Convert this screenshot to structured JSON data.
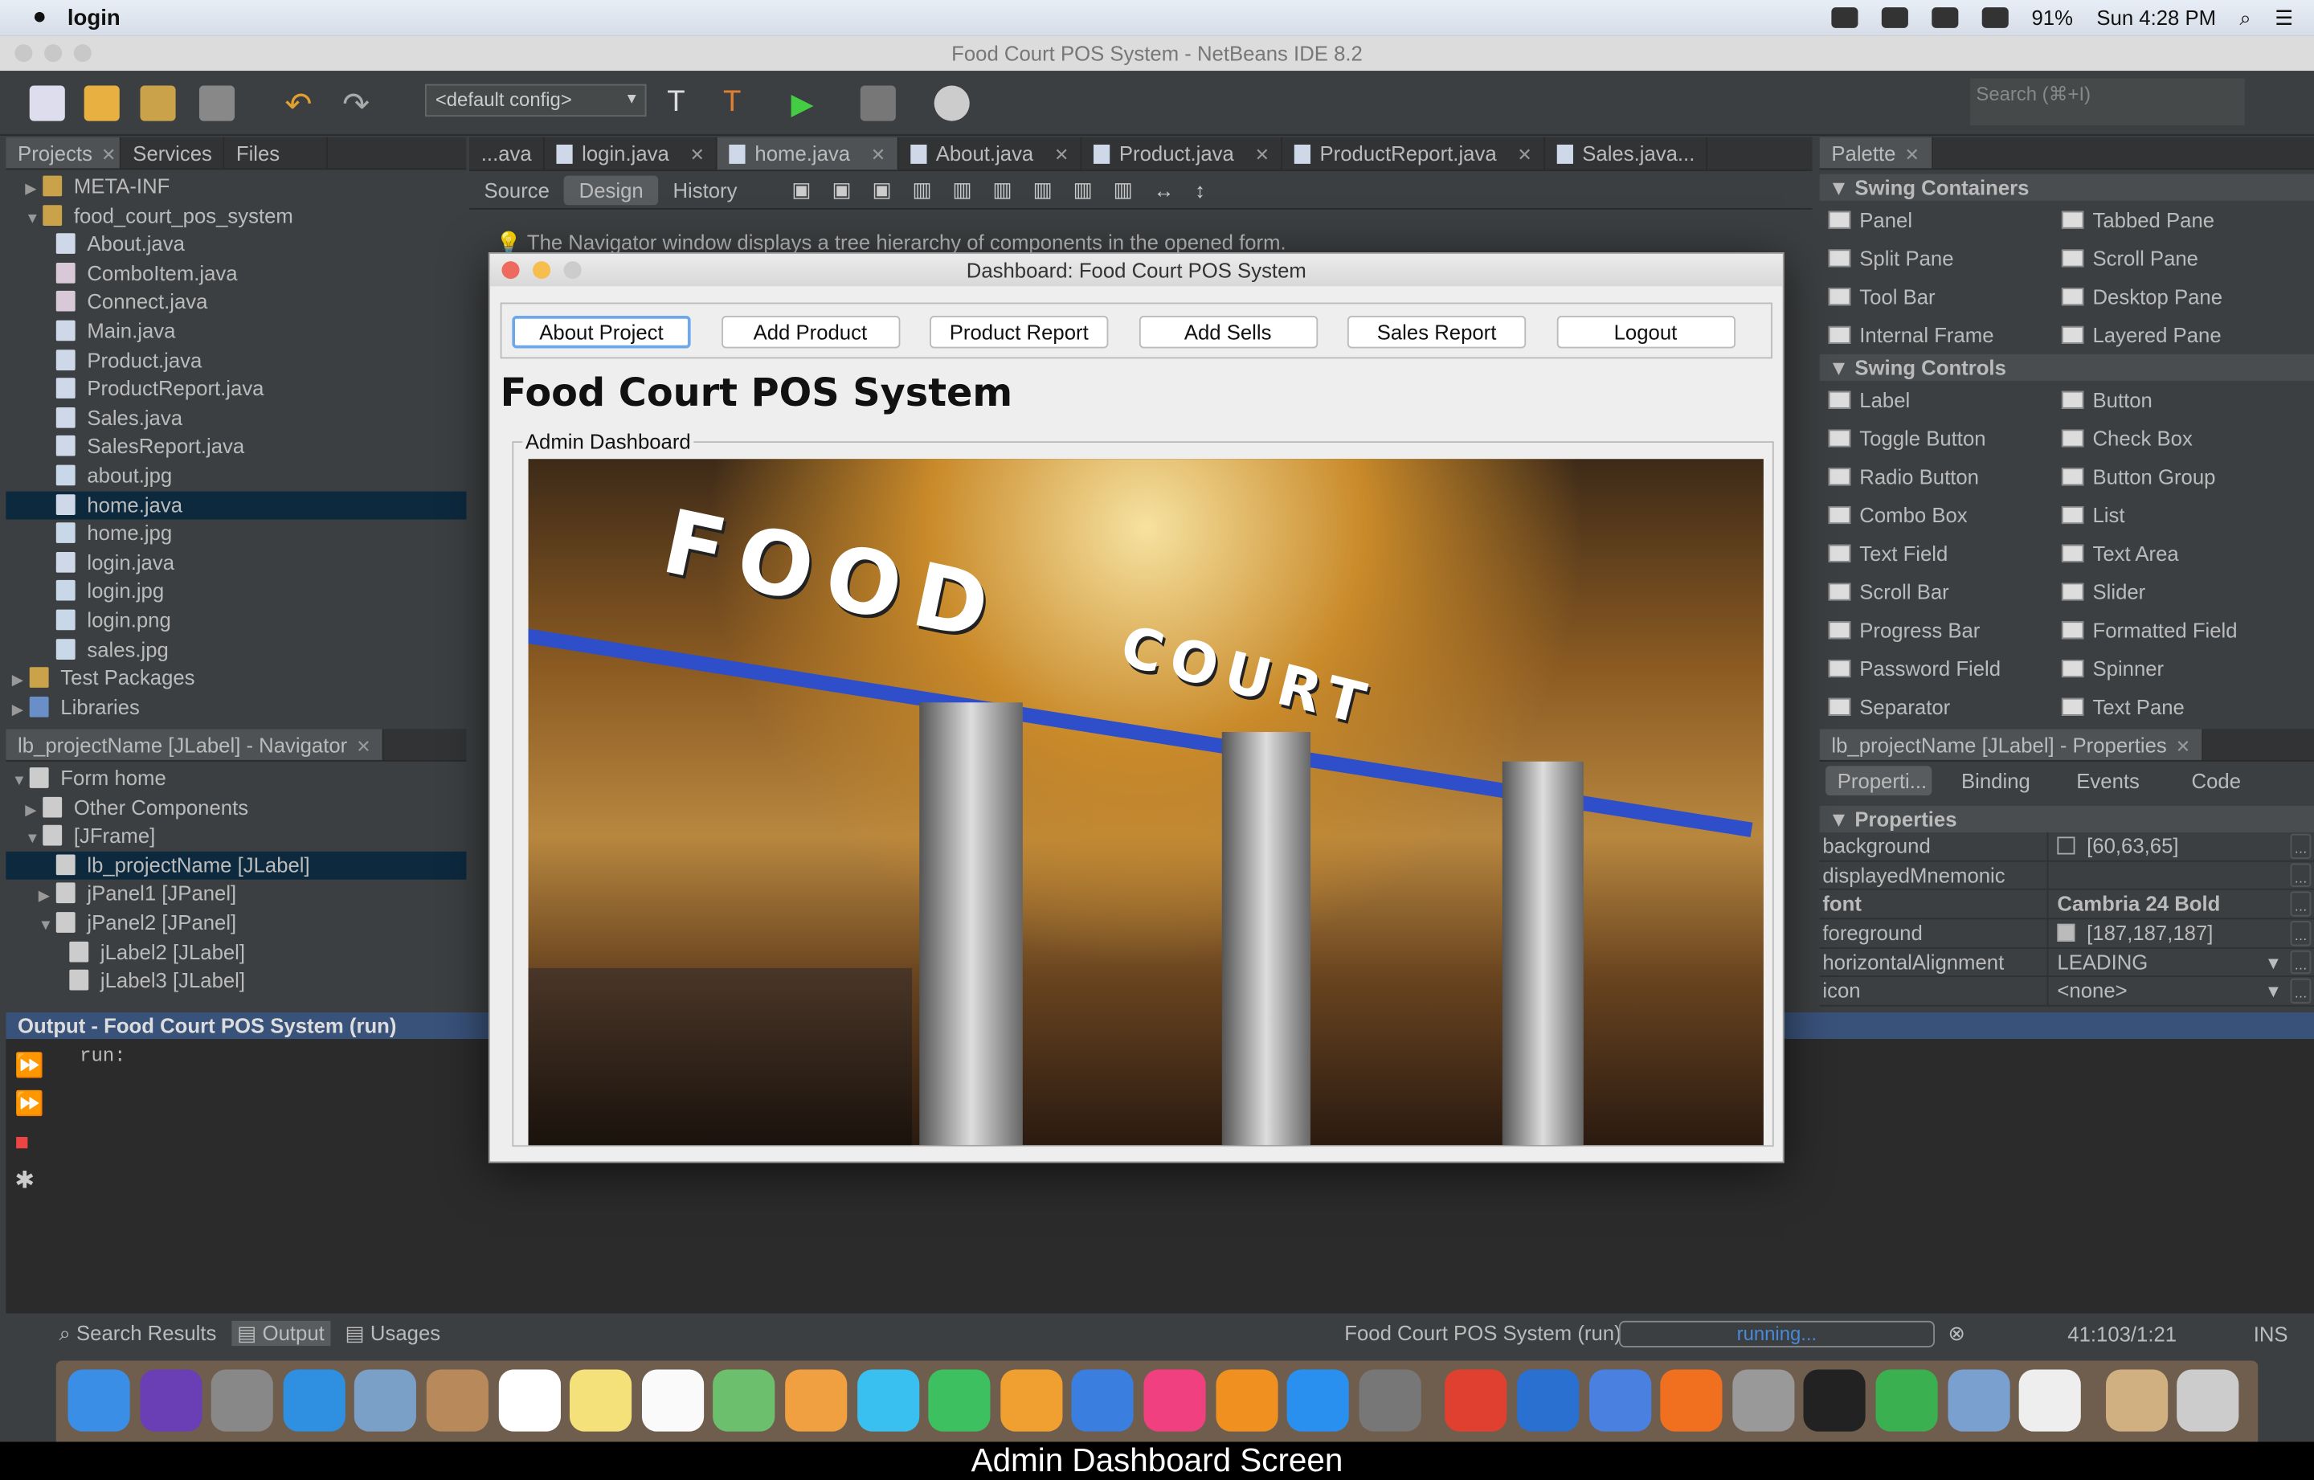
{
  "menubar": {
    "app": "login",
    "clock": "Sun 4:28 PM",
    "battery": "91%"
  },
  "window": {
    "title": "Food Court POS System - NetBeans IDE 8.2"
  },
  "toolbar": {
    "config": "<default config>",
    "search_placeholder": "Search (⌘+I)"
  },
  "projects": {
    "tabs": [
      "Projects",
      "Services",
      "Files"
    ],
    "tree": [
      {
        "label": "META-INF",
        "depth": 1,
        "arrow": "▶",
        "icon": "package"
      },
      {
        "label": "food_court_pos_system",
        "depth": 1,
        "arrow": "▼",
        "icon": "package"
      },
      {
        "label": "About.java",
        "depth": 2,
        "icon": "form"
      },
      {
        "label": "ComboItem.java",
        "depth": 2,
        "icon": "java"
      },
      {
        "label": "Connect.java",
        "depth": 2,
        "icon": "java"
      },
      {
        "label": "Main.java",
        "depth": 2,
        "icon": "form"
      },
      {
        "label": "Product.java",
        "depth": 2,
        "icon": "form"
      },
      {
        "label": "ProductReport.java",
        "depth": 2,
        "icon": "form"
      },
      {
        "label": "Sales.java",
        "depth": 2,
        "icon": "form"
      },
      {
        "label": "SalesReport.java",
        "depth": 2,
        "icon": "form"
      },
      {
        "label": "about.jpg",
        "depth": 2,
        "icon": "image"
      },
      {
        "label": "home.java",
        "depth": 2,
        "icon": "form",
        "selected": true
      },
      {
        "label": "home.jpg",
        "depth": 2,
        "icon": "image"
      },
      {
        "label": "login.java",
        "depth": 2,
        "icon": "form"
      },
      {
        "label": "login.jpg",
        "depth": 2,
        "icon": "image"
      },
      {
        "label": "login.png",
        "depth": 2,
        "icon": "image"
      },
      {
        "label": "sales.jpg",
        "depth": 2,
        "icon": "image"
      },
      {
        "label": "Test Packages",
        "depth": 0,
        "arrow": "▶",
        "icon": "package"
      },
      {
        "label": "Libraries",
        "depth": 0,
        "arrow": "▶",
        "icon": "library"
      }
    ]
  },
  "navigator": {
    "title": "lb_projectName [JLabel] - Navigator",
    "tree": [
      {
        "label": "Form home",
        "depth": 0,
        "arrow": "▼"
      },
      {
        "label": "Other Components",
        "depth": 1,
        "arrow": "▶"
      },
      {
        "label": "[JFrame]",
        "depth": 1,
        "arrow": "▼"
      },
      {
        "label": "lb_projectName [JLabel]",
        "depth": 2,
        "selected": true
      },
      {
        "label": "jPanel1 [JPanel]",
        "depth": 2,
        "arrow": "▶"
      },
      {
        "label": "jPanel2 [JPanel]",
        "depth": 2,
        "arrow": "▼"
      },
      {
        "label": "jLabel2 [JLabel]",
        "depth": 3
      },
      {
        "label": "jLabel3 [JLabel]",
        "depth": 3
      }
    ]
  },
  "editor": {
    "tabs": [
      {
        "label": "...ava"
      },
      {
        "label": "login.java"
      },
      {
        "label": "home.java",
        "active": true
      },
      {
        "label": "About.java"
      },
      {
        "label": "Product.java"
      },
      {
        "label": "ProductReport.java"
      },
      {
        "label": "Sales.java..."
      }
    ],
    "modes": [
      "Source",
      "Design",
      "History"
    ],
    "active_mode": "Design",
    "hint": "The Navigator window displays a tree hierarchy of components in the opened form."
  },
  "dialog": {
    "title": "Dashboard: Food Court POS System",
    "buttons": [
      "About Project",
      "Add Product",
      "Product Report",
      "Add Sells",
      "Sales Report",
      "Logout"
    ],
    "heading": "Food Court POS System",
    "panel_title": "Admin Dashboard",
    "photo_sign": "FOOD COURT"
  },
  "palette": {
    "title": "Palette",
    "categories": [
      {
        "name": "Swing Containers",
        "items": [
          "Panel",
          "Tabbed Pane",
          "Split Pane",
          "Scroll Pane",
          "Tool Bar",
          "Desktop Pane",
          "Internal Frame",
          "Layered Pane"
        ]
      },
      {
        "name": "Swing Controls",
        "items": [
          "Label",
          "Button",
          "Toggle Button",
          "Check Box",
          "Radio Button",
          "Button Group",
          "Combo Box",
          "List",
          "Text Field",
          "Text Area",
          "Scroll Bar",
          "Slider",
          "Progress Bar",
          "Formatted Field",
          "Password Field",
          "Spinner",
          "Separator",
          "Text Pane"
        ]
      }
    ]
  },
  "properties": {
    "title": "lb_projectName [JLabel] - Properties",
    "tabs": [
      "Properti...",
      "Binding",
      "Events",
      "Code"
    ],
    "section": "Properties",
    "rows": [
      {
        "name": "background",
        "value": "[60,63,65]",
        "swatch": "#3c3f41"
      },
      {
        "name": "displayedMnemonic",
        "value": ""
      },
      {
        "name": "font",
        "value": "Cambria 24 Bold",
        "bold": true
      },
      {
        "name": "foreground",
        "value": "[187,187,187]",
        "swatch": "#bbbbbb"
      },
      {
        "name": "horizontalAlignment",
        "value": "LEADING",
        "dropdown": true
      },
      {
        "name": "icon",
        "value": "<none>",
        "dropdown": true
      }
    ]
  },
  "output": {
    "title": "Output - Food Court POS System (run)",
    "text": "run:"
  },
  "status": {
    "tabs": [
      "Search Results",
      "Output",
      "Usages"
    ],
    "task": "Food Court POS System (run)",
    "progress_text": "running...",
    "position": "41:103/1:21",
    "mode": "INS"
  },
  "dock": {
    "apps": [
      {
        "name": "finder",
        "color": "#3a8ee6"
      },
      {
        "name": "siri",
        "color": "#6a3fb5"
      },
      {
        "name": "launchpad",
        "color": "#888"
      },
      {
        "name": "safari",
        "color": "#2f8fe0"
      },
      {
        "name": "mail",
        "color": "#7aa0c8"
      },
      {
        "name": "contacts",
        "color": "#b8895a"
      },
      {
        "name": "calendar",
        "color": "#fff"
      },
      {
        "name": "notes",
        "color": "#f5e17a"
      },
      {
        "name": "reminders",
        "color": "#fafafa"
      },
      {
        "name": "maps",
        "color": "#6cbf6c"
      },
      {
        "name": "photos",
        "color": "#f0a040"
      },
      {
        "name": "messages",
        "color": "#3ac0f0"
      },
      {
        "name": "facetime",
        "color": "#3cc060"
      },
      {
        "name": "pages",
        "color": "#f0a030"
      },
      {
        "name": "keynote",
        "color": "#3a7ee0"
      },
      {
        "name": "itunes",
        "color": "#f04080"
      },
      {
        "name": "ibooks",
        "color": "#f09020"
      },
      {
        "name": "app-store",
        "color": "#2a90f0"
      },
      {
        "name": "system-preferences",
        "color": "#777"
      },
      {
        "name": "chrome",
        "color": "#e04030"
      },
      {
        "name": "teamviewer",
        "color": "#2a70d0"
      },
      {
        "name": "chrome-canary",
        "color": "#4a80e0"
      },
      {
        "name": "firefox",
        "color": "#f07020"
      },
      {
        "name": "calculator",
        "color": "#999"
      },
      {
        "name": "terminal",
        "color": "#222"
      },
      {
        "name": "numbers",
        "color": "#3ab050"
      },
      {
        "name": "virtualbox",
        "color": "#7aa0d0"
      },
      {
        "name": "java",
        "color": "#eee"
      },
      {
        "name": "preview",
        "color": "#d0b080"
      },
      {
        "name": "trash",
        "color": "#ccc"
      }
    ]
  },
  "caption": "Admin Dashboard Screen"
}
